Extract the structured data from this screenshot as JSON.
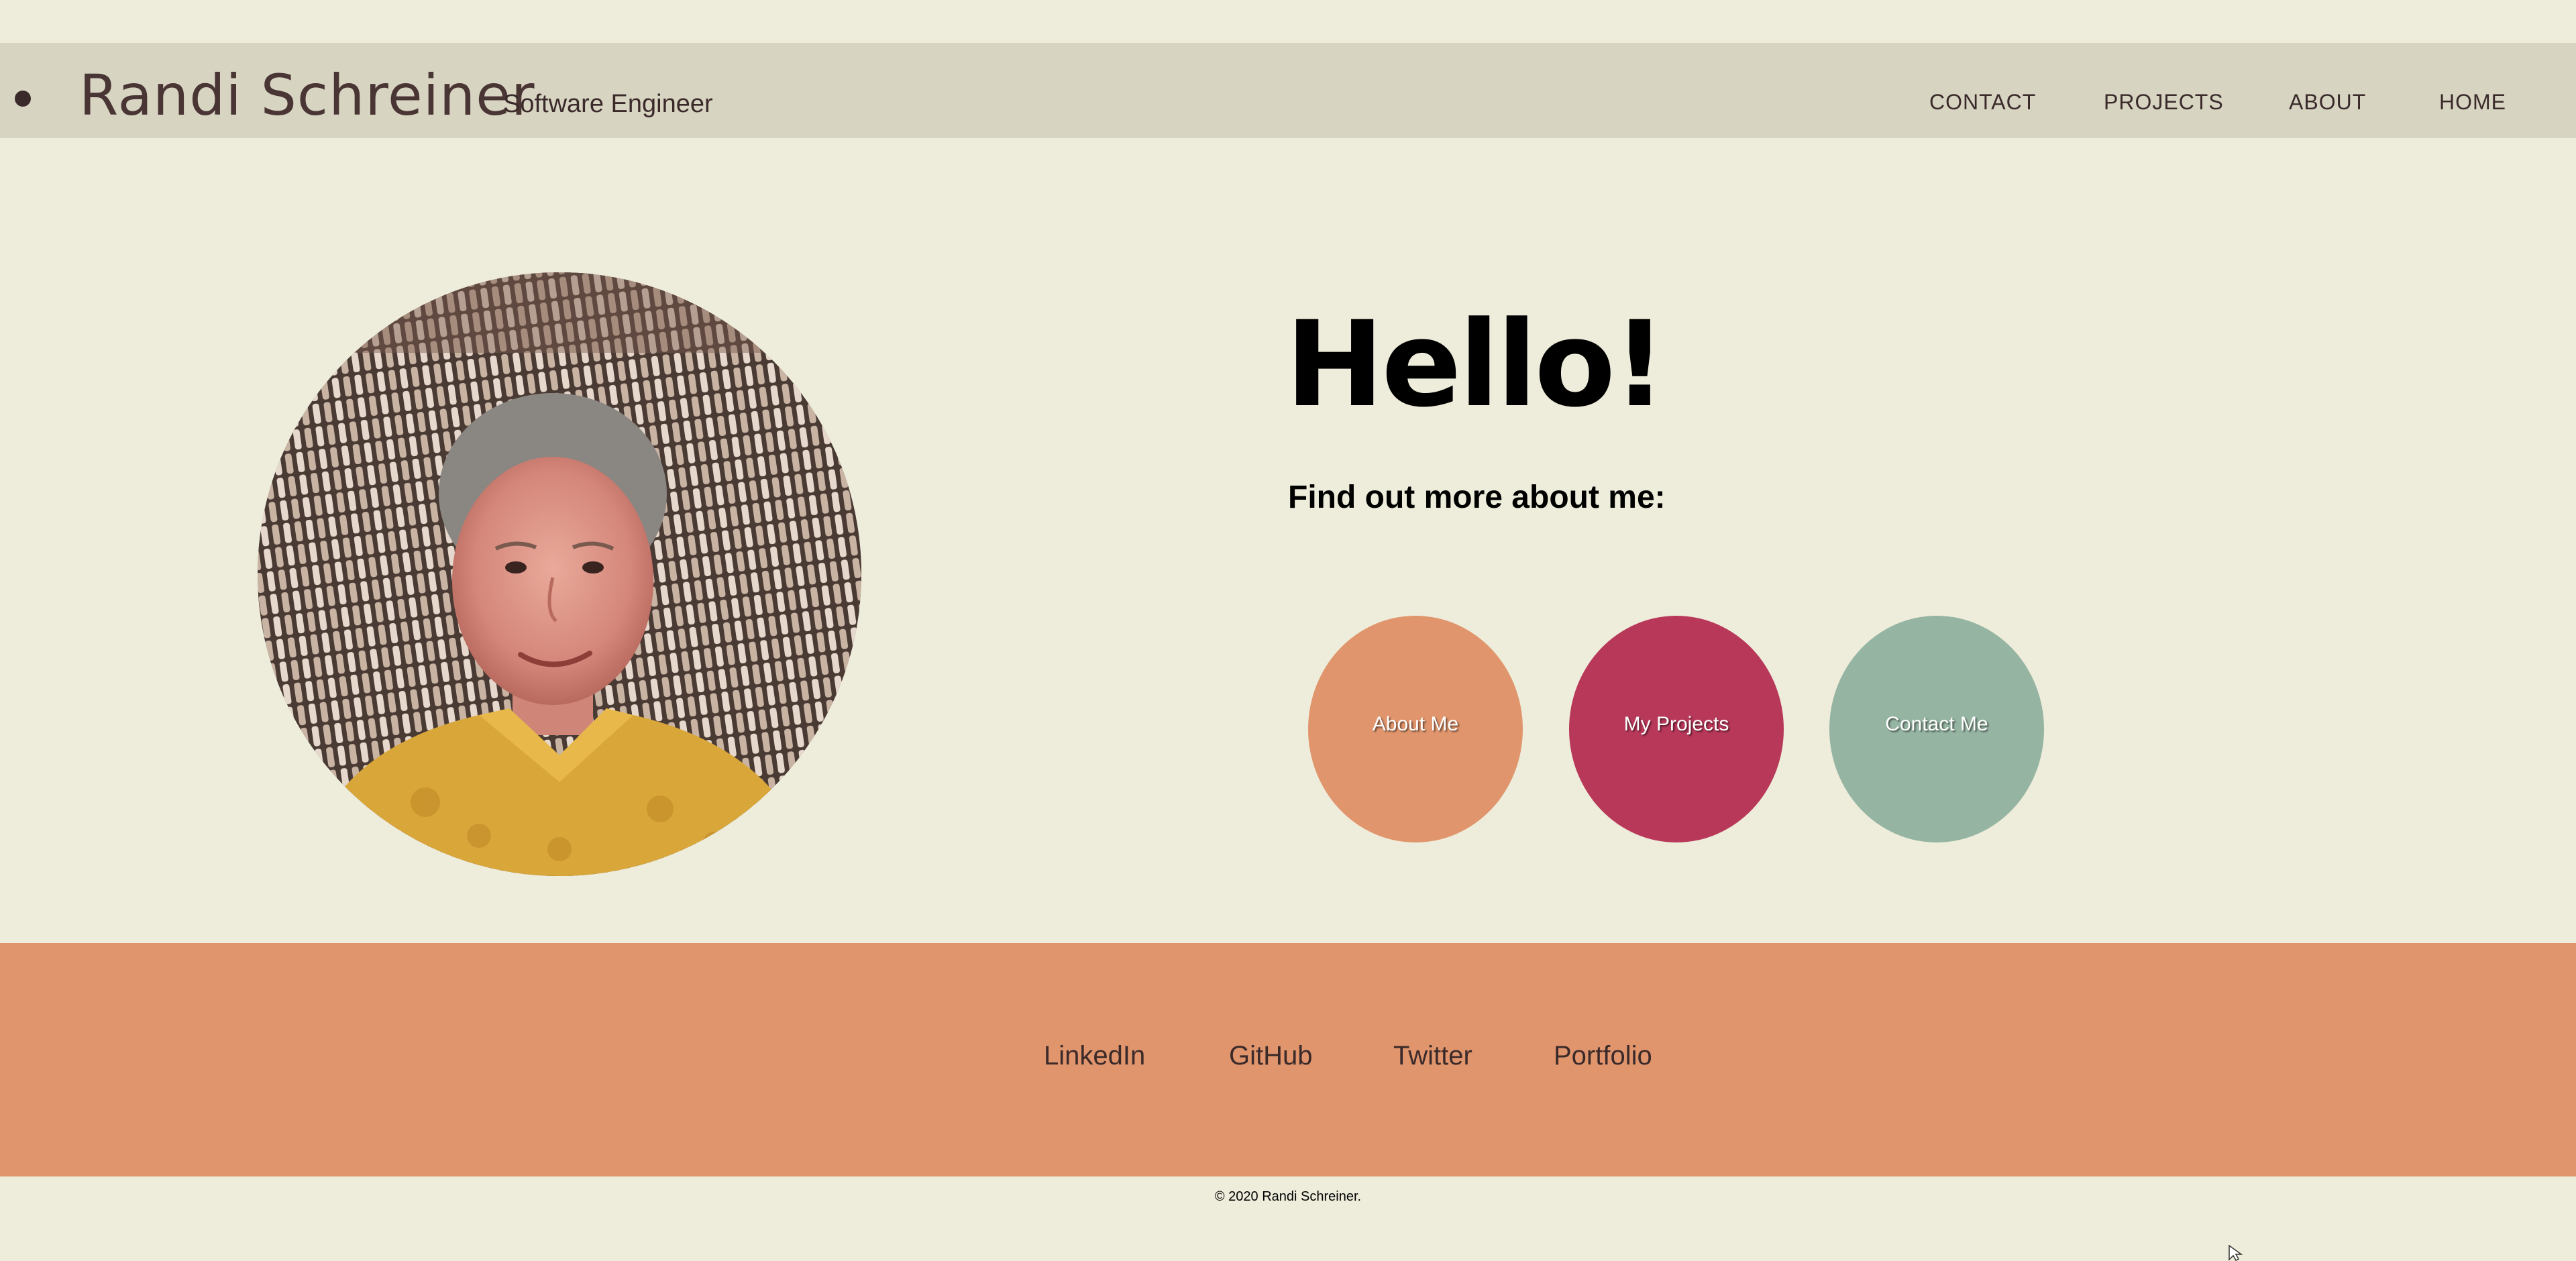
{
  "header": {
    "brand_name": "Randi Schreiner",
    "subtitle": "Software Engineer",
    "nav": [
      {
        "label": "CONTACT"
      },
      {
        "label": "PROJECTS"
      },
      {
        "label": "ABOUT"
      },
      {
        "label": "HOME"
      }
    ]
  },
  "hero": {
    "portrait_alt": "Randi Schreiner",
    "greeting": "Hello!",
    "prompt": "Find out more about me:",
    "buttons": [
      {
        "label": "About Me",
        "color": "#e0956c"
      },
      {
        "label": "My Projects",
        "color": "#b8385a"
      },
      {
        "label": "Contact Me",
        "color": "#95b4a2"
      }
    ]
  },
  "footer": {
    "links": [
      {
        "label": "LinkedIn"
      },
      {
        "label": "GitHub"
      },
      {
        "label": "Twitter"
      },
      {
        "label": "Portfolio"
      }
    ],
    "copyright": "© 2020 Randi Schreiner."
  },
  "colors": {
    "background": "#eeecda",
    "navbar": "#d7d4c2",
    "footer": "#e0956c",
    "text": "#3b2a2a"
  }
}
